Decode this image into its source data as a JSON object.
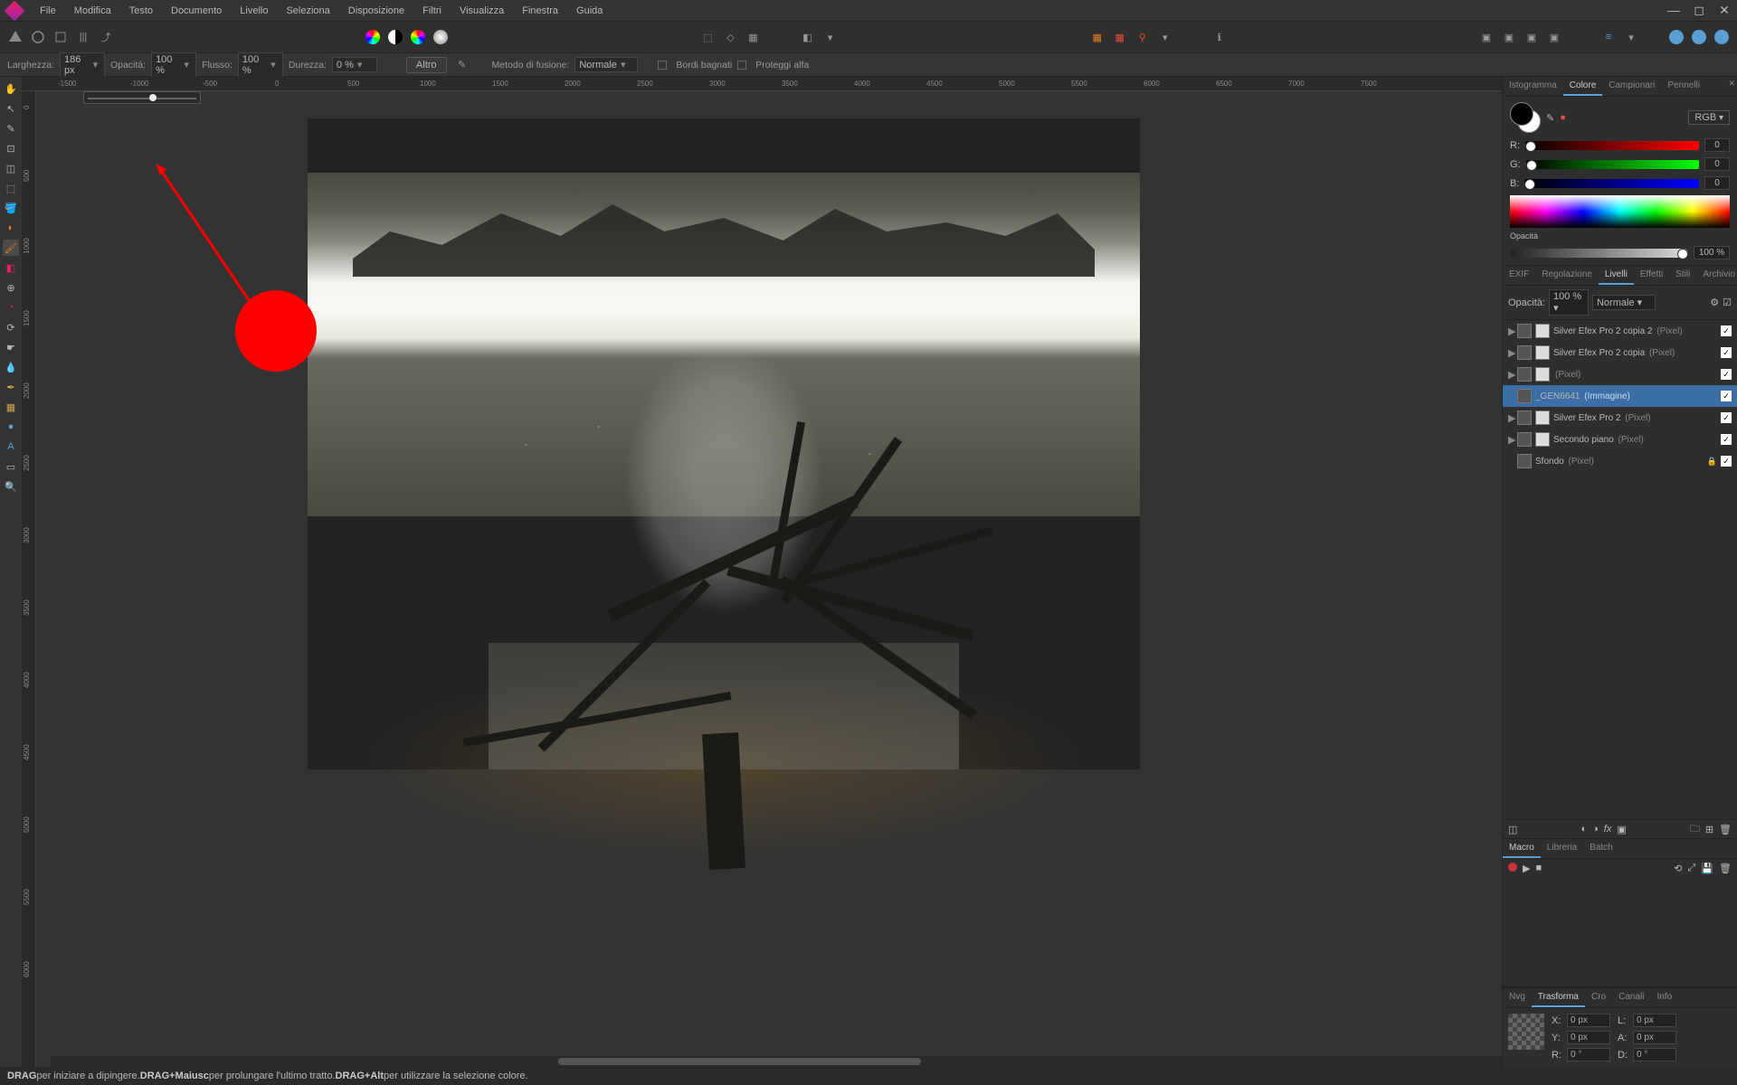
{
  "menubar": {
    "items": [
      "File",
      "Modifica",
      "Testo",
      "Documento",
      "Livello",
      "Seleziona",
      "Disposizione",
      "Filtri",
      "Visualizza",
      "Finestra",
      "Guida"
    ]
  },
  "context": {
    "width_label": "Larghezza:",
    "width_value": "186 px",
    "opacity_label": "Opacità:",
    "opacity_value": "100 %",
    "flow_label": "Flusso:",
    "flow_value": "100 %",
    "hardness_label": "Durezza:",
    "hardness_value": "0 %",
    "more_btn": "Altro",
    "blend_label": "Metodo di fusione:",
    "blend_value": "Normale",
    "wet_edges": "Bordi bagnati",
    "protect_alpha": "Proteggi alfa"
  },
  "ruler_h": [
    "-1500",
    "-1000",
    "-500",
    "0",
    "500",
    "1000",
    "1500",
    "2000",
    "2500",
    "3000",
    "3500",
    "4000",
    "4500",
    "5000",
    "5500",
    "6000",
    "6500",
    "7000",
    "7500"
  ],
  "ruler_v": [
    "0",
    "500",
    "1000",
    "1500",
    "2000",
    "2500",
    "3000",
    "3500",
    "4000",
    "4500",
    "5000",
    "5500",
    "6000"
  ],
  "panels": {
    "top_tabs": [
      "Istogramma",
      "Colore",
      "Campionari",
      "Pennelli"
    ],
    "top_active": 1,
    "color_mode": "RGB",
    "rgb": {
      "r_label": "R:",
      "g_label": "G:",
      "b_label": "B:",
      "r": 0,
      "g": 0,
      "b": 0
    },
    "opacity_label": "Opacità",
    "opacity_value": "100 %",
    "mid_tabs": [
      "EXIF",
      "Regolazione",
      "Livelli",
      "Effetti",
      "Stili",
      "Archivio"
    ],
    "mid_active": 2,
    "layer_opacity_label": "Opacità:",
    "layer_opacity_value": "100 %",
    "layer_blend": "Normale",
    "layers": [
      {
        "name": "Silver Efex Pro 2 copia 2",
        "type": "(Pixel)",
        "arrow": true,
        "dbl": true
      },
      {
        "name": "Silver Efex Pro 2 copia",
        "type": "(Pixel)",
        "arrow": true,
        "dbl": true
      },
      {
        "name": "",
        "type": "(Pixel)",
        "arrow": true,
        "dbl": true
      },
      {
        "name": "_GEN6641",
        "type": "(Immagine)",
        "arrow": false,
        "selected": true
      },
      {
        "name": "Silver Efex Pro 2",
        "type": "(Pixel)",
        "arrow": true,
        "dbl": true
      },
      {
        "name": "Secondo piano",
        "type": "(Pixel)",
        "arrow": true,
        "dbl": true
      },
      {
        "name": "Sfondo",
        "type": "(Pixel)",
        "arrow": false,
        "locked": true
      }
    ],
    "macro_tabs": [
      "Macro",
      "Libreria",
      "Batch"
    ],
    "macro_active": 0,
    "bottom_tabs": [
      "Nvg",
      "Trasforma",
      "Cro",
      "Canali",
      "Info"
    ],
    "bottom_active": 1,
    "transform": {
      "x_label": "X:",
      "x": "0 px",
      "y_label": "Y:",
      "y": "0 px",
      "l_label": "L:",
      "l": "0 px",
      "a_label": "A:",
      "a": "0 px",
      "r_label": "R:",
      "r": "0 °",
      "d_label": "D:",
      "d": "0 °"
    }
  },
  "statusbar": {
    "drag": "DRAG",
    "drag_txt": " per iniziare a dipingere. ",
    "drag_shift": "DRAG+Maiusc",
    "drag_shift_txt": " per prolungare l'ultimo tratto. ",
    "drag_alt": "DRAG+Alt",
    "drag_alt_txt": " per utilizzare la selezione colore."
  }
}
